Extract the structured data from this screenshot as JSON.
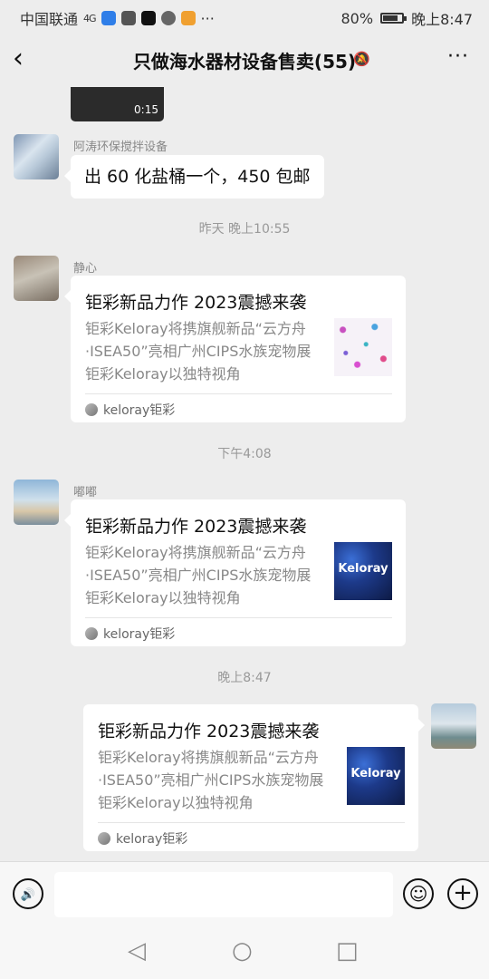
{
  "status_bar": {
    "carrier": "中国联通",
    "signal": "4G",
    "battery": "80%",
    "battery_level": 0.8,
    "time": "晚上8:47",
    "more": "···"
  },
  "header": {
    "back": "‹",
    "title": "只做海水器材设备售卖(55)",
    "mute_icon": "🔕",
    "more": "···"
  },
  "chat": {
    "video_duration": "0:15",
    "messages": [
      {
        "type": "text",
        "sender": "阿涛环保搅拌设备",
        "text": "出 60 化盐桶一个，450 包邮"
      },
      {
        "type": "timestamp",
        "text": "昨天 晚上10:55"
      },
      {
        "type": "card",
        "sender": "静心",
        "title": "钜彩新品力作 2023震撼来袭",
        "desc_lines": [
          "钜彩Keloray将携旗舰新品“云方舟",
          "·ISEA50”亮相广州CIPS水族宠物展",
          "钜彩Keloray以独特视角"
        ],
        "source": "keloray钜彩"
      },
      {
        "type": "timestamp",
        "text": "下午4:08"
      },
      {
        "type": "card",
        "sender": "嘟嘟",
        "title": "钜彩新品力作 2023震撼来袭",
        "desc_lines": [
          "钜彩Keloray将携旗舰新品“云方舟",
          "·ISEA50”亮相广州CIPS水族宠物展",
          "钜彩Keloray以独特视角"
        ],
        "thumb_text": "Keloray",
        "source": "keloray钜彩"
      },
      {
        "type": "timestamp",
        "text": "晚上8:47"
      },
      {
        "type": "card",
        "sender": "me",
        "title": "钜彩新品力作 2023震撼来袭",
        "desc_lines": [
          "钜彩Keloray将携旗舰新品“云方舟",
          "·ISEA50”亮相广州CIPS水族宠物展",
          "钜彩Keloray以独特视角"
        ],
        "thumb_text": "Keloray",
        "source": "keloray钜彩"
      }
    ]
  },
  "input_bar": {
    "voice_icon": "🔊",
    "input_value": "",
    "emoji_icon": "☺",
    "plus_icon": "+"
  },
  "nav_bar": {
    "back_icon": "◁",
    "home_icon": "○",
    "recent_icon": "□"
  }
}
